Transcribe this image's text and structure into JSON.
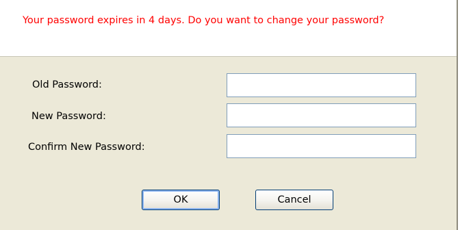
{
  "message": "Your password expires in 4 days. Do you want to change your password?",
  "fields": [
    {
      "label": "Old Password:",
      "value": ""
    },
    {
      "label": "New Password:",
      "value": ""
    },
    {
      "label": "Confirm New Password:",
      "value": ""
    }
  ],
  "buttons": {
    "ok_label": "OK",
    "cancel_label": "Cancel"
  },
  "colors": {
    "warning_text": "#ff0000",
    "dialog_bg": "#ece9d8",
    "header_bg": "#ffffff",
    "input_border": "#7f9db9",
    "button_border": "#003c74"
  }
}
